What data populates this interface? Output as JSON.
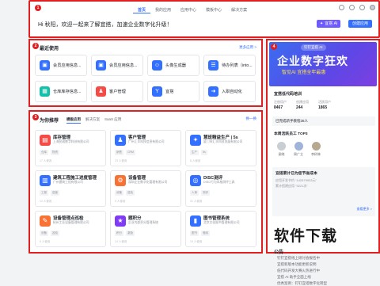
{
  "badges": {
    "top": "1",
    "recent": "2",
    "recommend": "3",
    "right": "4"
  },
  "nav": {
    "items": [
      "首页",
      "我的应用",
      "应用中心",
      "模板中心",
      "解决方案"
    ],
    "active": 0
  },
  "welcome": "Hi 秋阳，欢迎一起来了解宜搭，加速企业数字化升级！",
  "buttons": {
    "enterprise": "宜搭 AI",
    "create": "创建应用"
  },
  "icons": {
    "top_right": [
      "help-icon",
      "bell-icon",
      "settings-icon",
      "user-icon"
    ]
  },
  "recent": {
    "title": "最近使用",
    "more": "更多应用 >",
    "items": [
      {
        "label": "会员应用信息...",
        "icon": "user-card-icon",
        "color": "#3370ff",
        "glyph": "▣"
      },
      {
        "label": "会员应用信息...",
        "icon": "user-card-icon",
        "color": "#3370ff",
        "glyph": "▣"
      },
      {
        "label": "头像生成器",
        "icon": "avatar-icon",
        "color": "#3370ff",
        "glyph": "☺"
      },
      {
        "label": "待办列表（into...",
        "icon": "todo-icon",
        "color": "#3370ff",
        "glyph": "☰"
      },
      {
        "label": "仓库库存信息...",
        "icon": "warehouse-icon",
        "color": "#14c0a8",
        "glyph": "▦"
      },
      {
        "label": "客户管理",
        "icon": "customer-icon",
        "color": "#f54a45",
        "glyph": "♟"
      },
      {
        "label": "宜搭",
        "icon": "yida-icon",
        "color": "#3370ff",
        "glyph": "Y"
      },
      {
        "label": "入职自动化",
        "icon": "onboarding-icon",
        "color": "#3370ff",
        "glyph": "➜"
      }
    ]
  },
  "recommend": {
    "title": "为你推荐",
    "tabs": [
      "模板应用",
      "解决方案",
      "SaaS 应用"
    ],
    "active_tab": 0,
    "more": "换一换",
    "apps": [
      {
        "title": "库存管理",
        "desc": "上海民政数字科技有限公司",
        "tags": [
          "仓库",
          "物资"
        ],
        "foot": "17 人使用",
        "icon": "inventory-icon",
        "color": "#f54a45",
        "glyph": "▤"
      },
      {
        "title": "客户管理",
        "desc": "广州汇丰科技信息有限公司",
        "tags": [
          "销售",
          "CRM"
        ],
        "foot": "23 人使用",
        "icon": "customer-icon",
        "color": "#3370ff",
        "glyph": "♟"
      },
      {
        "title": "慧班精益生产 | 5s",
        "desc": "厦门市汇丰科技发展有限公司",
        "tags": [
          "生产",
          "5s"
        ],
        "foot": "8 人使用",
        "icon": "production-icon",
        "color": "#3370ff",
        "glyph": "✦"
      },
      {
        "title": "建筑工程施工进度管理",
        "desc": "广州建筑工程有限公司",
        "tags": [
          "工程",
          "进度"
        ],
        "foot": "12 人使用",
        "icon": "construction-icon",
        "color": "#3370ff",
        "glyph": "▥"
      },
      {
        "title": "设备管理",
        "desc": "深圳企业数字化管理有限公司",
        "tags": [
          "设备",
          "巡检"
        ],
        "foot": "9 人使用",
        "icon": "device-icon",
        "color": "#f77234",
        "glyph": "⚙"
      },
      {
        "title": "DISC测评",
        "desc": "DISC行为风格测评工具",
        "tags": [
          "人事",
          "测评"
        ],
        "foot": "31 人使用",
        "icon": "disc-icon",
        "color": "#3370ff",
        "glyph": "◎"
      },
      {
        "title": "设备管理点巡检",
        "desc": "杭州工业设备管理有限公司",
        "tags": [
          "设备",
          "巡检"
        ],
        "foot": "6 人使用",
        "icon": "inspection-icon",
        "color": "#f77234",
        "glyph": "✎"
      },
      {
        "title": "题积分",
        "desc": "企业内部积分管理系统",
        "tags": [
          "积分",
          "激励"
        ],
        "foot": "14 人使用",
        "icon": "points-icon",
        "color": "#7f3bf5",
        "glyph": "★"
      },
      {
        "title": "图书管理系统",
        "desc": "北京文化图书管理有限公司",
        "tags": [
          "图书",
          "借阅"
        ],
        "foot": "19 人使用",
        "icon": "book-icon",
        "color": "#3370ff",
        "glyph": "▮"
      }
    ]
  },
  "right": {
    "banner": {
      "top": "钉钉宜搭 AI",
      "title": "企业数字狂欢",
      "sub": "智见AI 宜搭全年最惠"
    },
    "training_title": "宜搭低代码培训",
    "stats": [
      {
        "label": "注册用户",
        "value": "8467"
      },
      {
        "label": "创建应用",
        "value": "244"
      },
      {
        "label": "活跃用户",
        "value": "1865"
      }
    ],
    "joined": "已完成新手教程36人",
    "top3_title": "本周活跃员工 TOP3",
    "top3": [
      "梁晓",
      "周广立",
      "李树林"
    ],
    "promo_title": "宜搭累计已为您节省成本",
    "promo_lines": [
      "应用开发节约 “142579933元”",
      "累计搭建应用 “3221次”"
    ],
    "promo_more": "查看更多 >",
    "notice_title": "公告",
    "notices": [
      "钉钉宜搭线上研讨会报名中",
      "宜搭新版本功能更新说明",
      "低代码开发大赛火热进行中",
      "宜搭 AI 助手全面上线",
      "优秀案例：钉钉宜搭数字化转型"
    ]
  },
  "watermark": "软件下载"
}
